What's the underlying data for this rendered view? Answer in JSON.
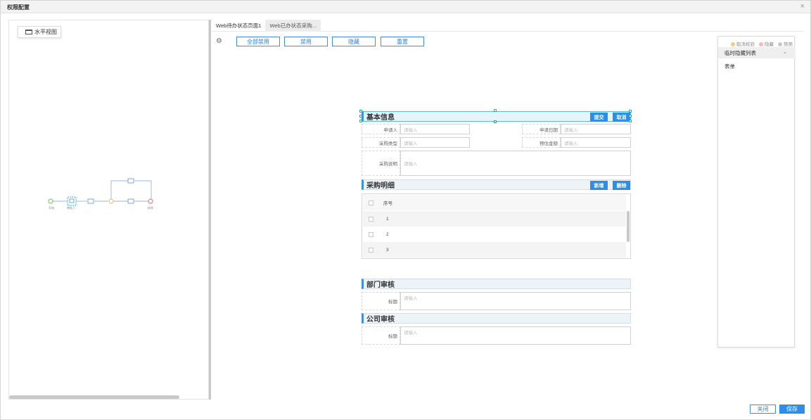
{
  "dialog": {
    "title": "权限配置",
    "close_icon": "×"
  },
  "left": {
    "view_label": "水平视图"
  },
  "flow": {
    "node_labels": [
      "开始",
      "审批人",
      "结束"
    ]
  },
  "tabs": [
    "Web待办状态页面1",
    "Web已办状态采购..."
  ],
  "toolbar": {
    "buttons": [
      "全部禁用",
      "禁用",
      "隐藏",
      "重置"
    ]
  },
  "form": {
    "sections": {
      "basic": "基本信息",
      "detail": "采购明细",
      "dept": "部门审核",
      "company": "公司审核"
    },
    "basic_buttons": [
      "提交",
      "取消"
    ],
    "detail_buttons": [
      "新增",
      "删除"
    ],
    "fields": {
      "applicant": "申请人",
      "apply_date": "申请日期",
      "purchase_type": "采购类型",
      "budget": "预估金额",
      "purchase_desc": "采购说明",
      "opinion": "标题"
    },
    "placeholder": "请输入",
    "table": {
      "header": "序号",
      "rows": [
        "1",
        "2",
        "3"
      ]
    }
  },
  "hidden_panel": {
    "legend": [
      "取消校验",
      "隐藏",
      "禁用"
    ],
    "title": "临时隐藏列表",
    "items": [
      "表单"
    ]
  },
  "footer": {
    "close": "关闭",
    "save": "保存"
  },
  "colors": {
    "primary": "#2d8ee8",
    "accent_border": "#3d8fe0",
    "selection": "#26a3d8",
    "legend_orange": "#f3c88a",
    "legend_pink": "#f4b9b9",
    "legend_gray": "#c8c8c8"
  }
}
